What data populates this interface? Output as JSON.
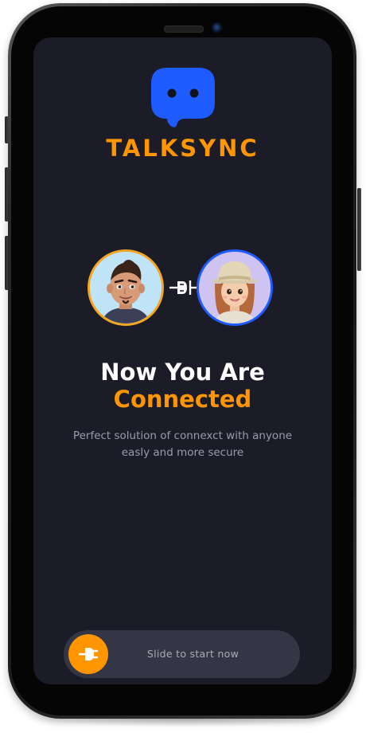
{
  "app": {
    "name": "TALKSYNC"
  },
  "connection": {
    "user_left_avatar": "man-memoji-avatar",
    "user_right_avatar": "woman-memoji-avatar",
    "connector_icon": "plug-connector-icon"
  },
  "headline": {
    "line1": "Now You Are",
    "line2": "Connected"
  },
  "subtitle": {
    "line1": "Perfect solution of connexct with anyone",
    "line2": "easly and more secure"
  },
  "slider": {
    "label": "Slide to start now",
    "knob_icon": "plug-icon",
    "progress": 0
  },
  "colors": {
    "accent": "#ff9500",
    "background": "#1b1c28",
    "slider_track": "#343645",
    "headline": "#ffffff",
    "subtitle": "#9a9cab",
    "logo": "#1f5cff",
    "avatar_left_ring": "#f5a623",
    "avatar_right_ring": "#1f5cff"
  }
}
